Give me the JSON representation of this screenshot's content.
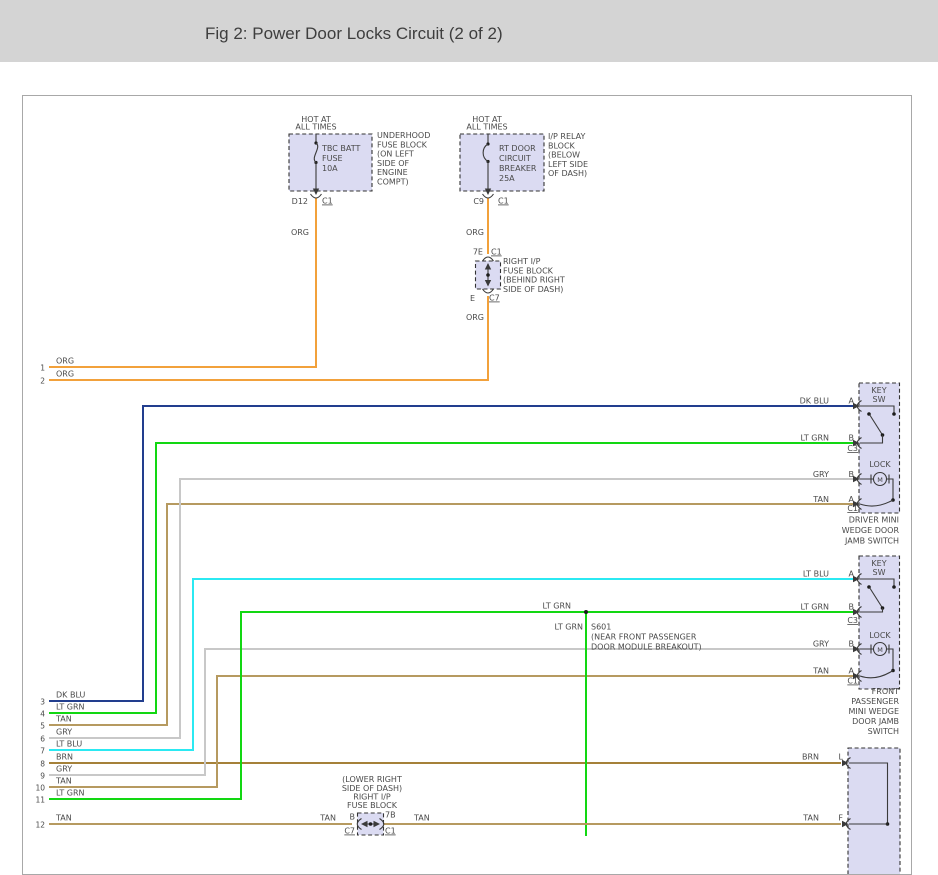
{
  "header": {
    "title": "Fig 2: Power Door Locks Circuit (2 of 2)"
  },
  "colors": {
    "ORG": "#f2a13b",
    "DK BLU": "#223e8e",
    "LT GRN": "#12d712",
    "TAN": "#b69a60",
    "GRY": "#c8c8c8",
    "LT BLU": "#2be9f2",
    "BRN": "#a58139"
  },
  "fuse1": {
    "hot": [
      "HOT AT",
      "ALL TIMES"
    ],
    "name": [
      "TBC BATT",
      "FUSE",
      "10A"
    ],
    "pin": "D12",
    "conn": "C1",
    "location": [
      "UNDERHOOD",
      "FUSE BLOCK",
      "(ON LEFT",
      "SIDE OF",
      "ENGINE",
      "COMPT)"
    ],
    "wire": "ORG"
  },
  "breaker": {
    "hot": [
      "HOT AT",
      "ALL TIMES"
    ],
    "name": [
      "RT DOOR",
      "CIRCUIT",
      "BREAKER",
      "25A"
    ],
    "pin": "C9",
    "conn": "C1",
    "location": [
      "I/P RELAY",
      "BLOCK",
      "(BELOW",
      "LEFT SIDE",
      "OF DASH)"
    ],
    "wire_above": "ORG",
    "wire_below": "ORG"
  },
  "ip_block": {
    "pin_top": "7E",
    "conn_top": "C1",
    "pin_bottom": "E",
    "conn_bottom": "C7",
    "location": [
      "RIGHT I/P",
      "FUSE BLOCK",
      "(BEHIND RIGHT",
      "SIDE OF DASH)"
    ]
  },
  "bus": [
    {
      "num": "1",
      "color": "ORG"
    },
    {
      "num": "2",
      "color": "ORG"
    },
    {
      "num": "3",
      "color": "DK BLU"
    },
    {
      "num": "4",
      "color": "LT GRN"
    },
    {
      "num": "5",
      "color": "TAN"
    },
    {
      "num": "6",
      "color": "GRY"
    },
    {
      "num": "7",
      "color": "LT BLU"
    },
    {
      "num": "8",
      "color": "BRN"
    },
    {
      "num": "9",
      "color": "GRY"
    },
    {
      "num": "10",
      "color": "TAN"
    },
    {
      "num": "11",
      "color": "LT GRN"
    },
    {
      "num": "12",
      "color": "TAN"
    }
  ],
  "driver": {
    "title": [
      "KEY",
      "SW"
    ],
    "lock": "LOCK",
    "motor": "M",
    "wire_a": "DK BLU",
    "wire_b": "LT GRN",
    "wire_lock_b": "GRY",
    "wire_lock_a": "TAN",
    "term_a": "A",
    "term_b": "B",
    "term_lock_b": "B",
    "term_lock_a": "A",
    "conn_key": "C3",
    "conn_lock": "C1",
    "caption": [
      "DRIVER MINI",
      "WEDGE DOOR",
      "JAMB SWITCH"
    ]
  },
  "passenger": {
    "title": [
      "KEY",
      "SW"
    ],
    "lock": "LOCK",
    "motor": "M",
    "wire_a": "LT BLU",
    "wire_b": "LT GRN",
    "wire_lock_b": "GRY",
    "wire_lock_a": "TAN",
    "term_a": "A",
    "term_b": "B",
    "term_lock_b": "B",
    "term_lock_a": "A",
    "conn_key": "C3",
    "conn_lock": "C1",
    "caption": [
      "FRONT",
      "PASSENGER",
      "MINI WEDGE",
      "DOOR JAMB",
      "SWITCH"
    ]
  },
  "splice": {
    "wire": "LT GRN",
    "branch": "LT GRN",
    "id": "S601",
    "note": [
      "(NEAR FRONT PASSENGER",
      "DOOR MODULE BREAKOUT)"
    ]
  },
  "lower_block": {
    "location": [
      "(LOWER RIGHT",
      "SIDE OF DASH)",
      "RIGHT I/P",
      "FUSE BLOCK"
    ],
    "wire_left": "TAN",
    "pin_left": "B",
    "conn_left": "C7",
    "pin_right": "7B",
    "conn_right": "C1",
    "wire_right": "TAN"
  },
  "rh_module": {
    "wire_l": "BRN",
    "term_l": "L",
    "wire_f": "TAN",
    "term_f": "F"
  }
}
